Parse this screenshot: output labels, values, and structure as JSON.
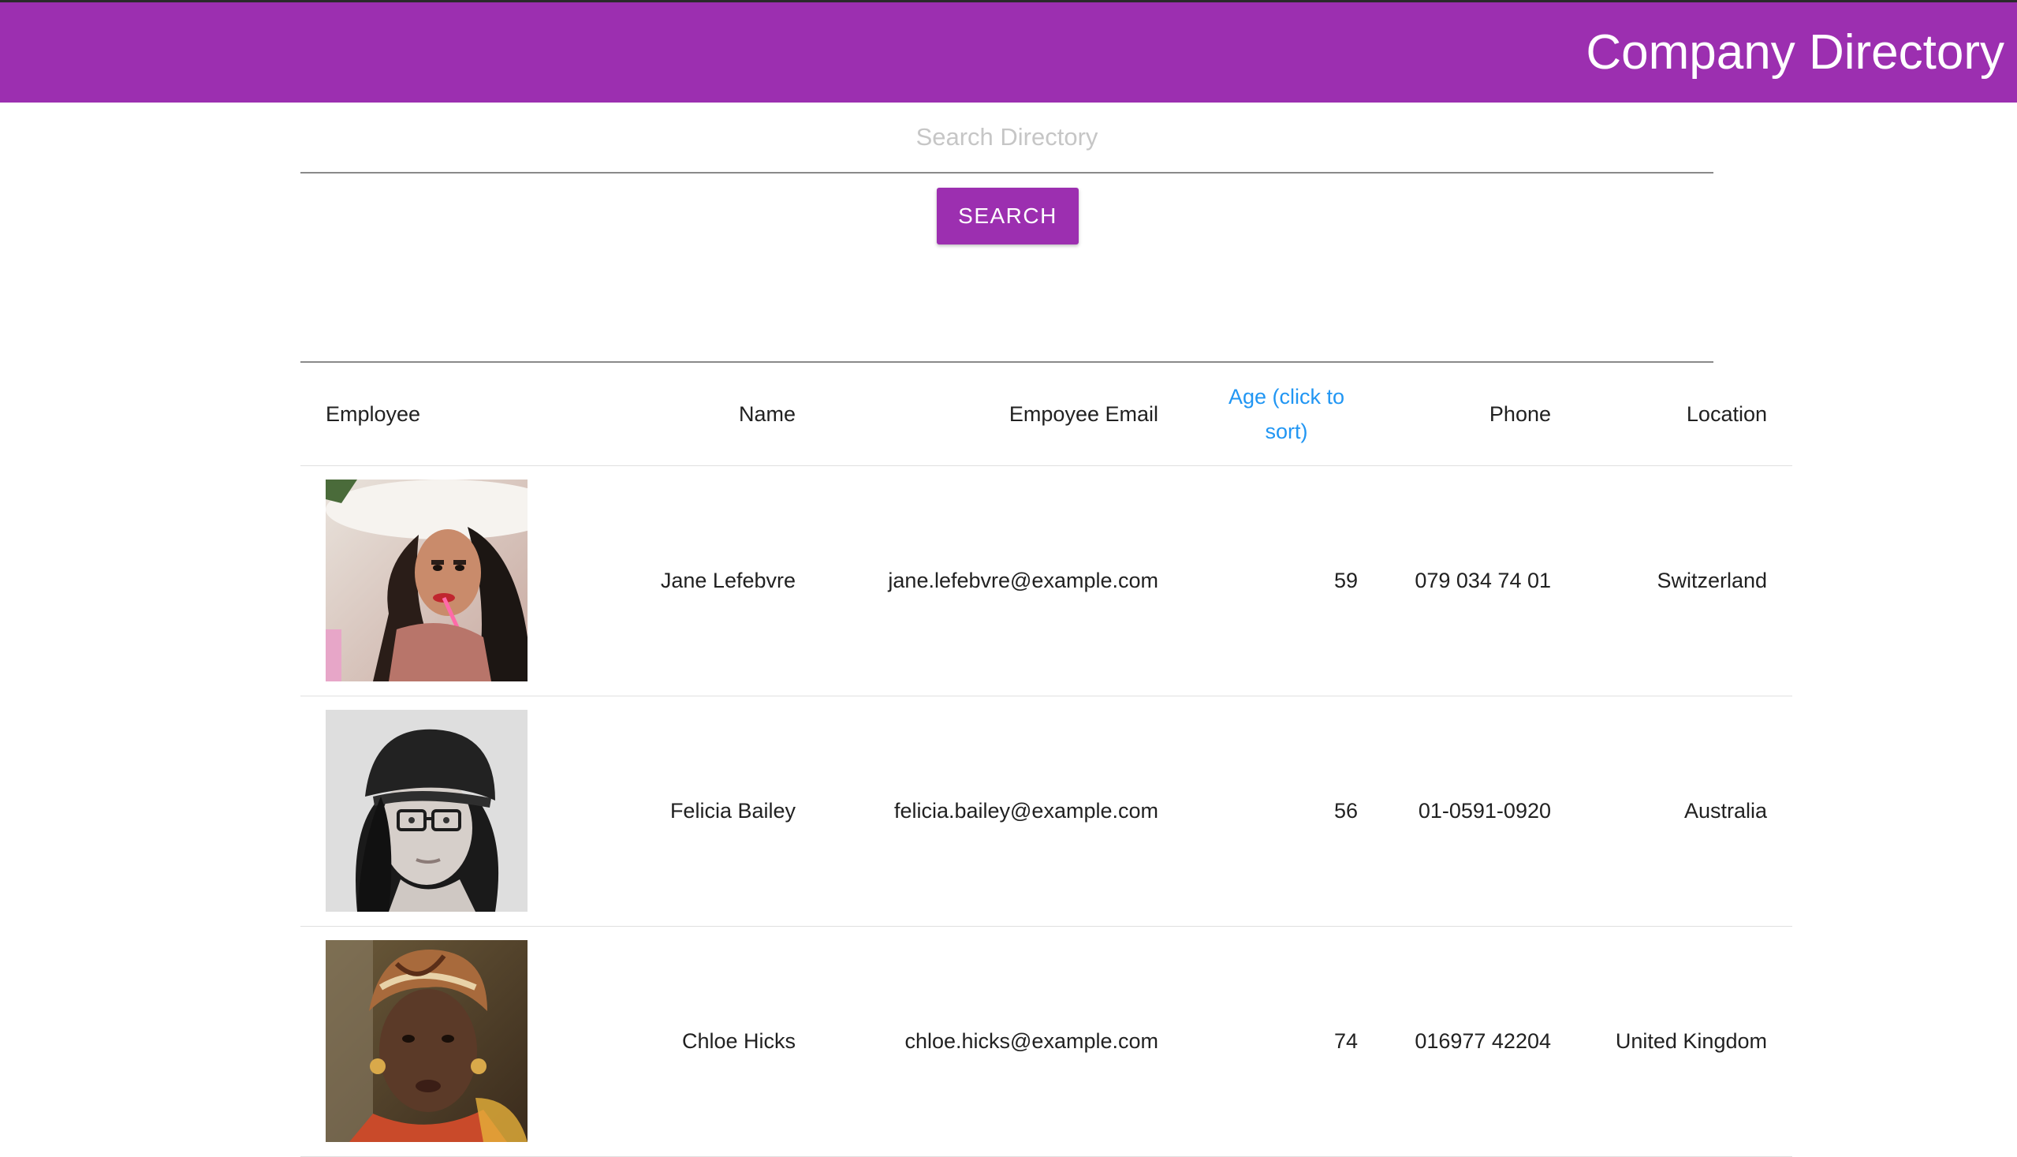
{
  "header": {
    "title": "Company Directory"
  },
  "search": {
    "placeholder": "Search Directory",
    "button_label": "SEARCH"
  },
  "table": {
    "columns": {
      "employee": "Employee",
      "name": "Name",
      "email": "Empoyee Email",
      "age": "Age (click to sort)",
      "phone": "Phone",
      "location": "Location"
    },
    "rows": [
      {
        "photo": "employee-photo-jane",
        "name": "Jane Lefebvre",
        "email": "jane.lefebvre@example.com",
        "age": "59",
        "phone": "079 034 74 01",
        "location": "Switzerland"
      },
      {
        "photo": "employee-photo-felicia",
        "name": "Felicia Bailey",
        "email": "felicia.bailey@example.com",
        "age": "56",
        "phone": "01-0591-0920",
        "location": "Australia"
      },
      {
        "photo": "employee-photo-chloe",
        "name": "Chloe Hicks",
        "email": "chloe.hicks@example.com",
        "age": "74",
        "phone": "016977 42204",
        "location": "United Kingdom"
      }
    ]
  },
  "colors": {
    "brand": "#9c2fb0",
    "link": "#2196f3"
  }
}
